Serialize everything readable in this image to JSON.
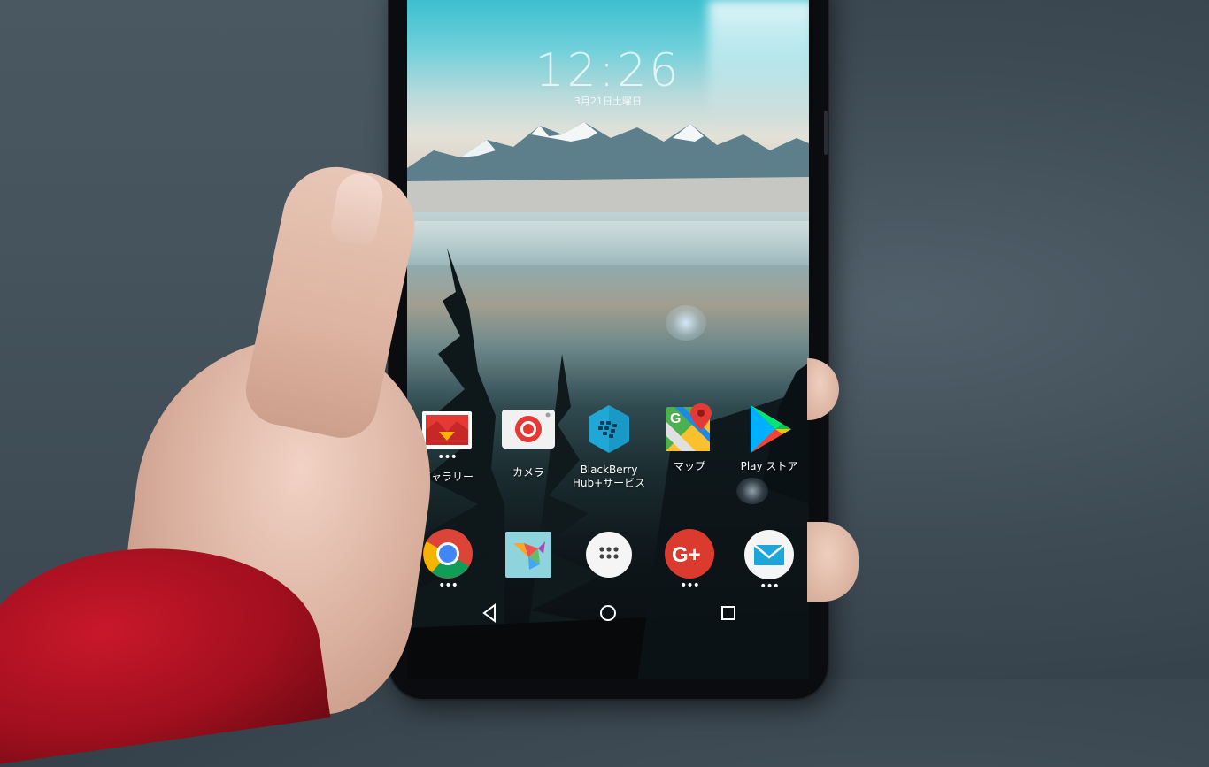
{
  "lockscreen": {
    "time": "12:26",
    "date": "3月21日土曜日"
  },
  "home_apps": [
    {
      "name": "gallery",
      "label": "ギャラリー",
      "icon": "gallery-icon",
      "has_dots": true
    },
    {
      "name": "camera",
      "label": "カメラ",
      "icon": "camera-icon",
      "has_dots": false
    },
    {
      "name": "blackberry-hub",
      "label_line1": "BlackBerry",
      "label_line2": "Hub+サービス",
      "icon": "blackberry-icon",
      "has_dots": false
    },
    {
      "name": "maps",
      "label": "マップ",
      "icon": "maps-icon",
      "has_dots": false
    },
    {
      "name": "play-store",
      "label": "Play ストア",
      "icon": "play-store-icon",
      "has_dots": false
    }
  ],
  "dock_apps": [
    {
      "name": "chrome",
      "icon": "chrome-icon",
      "has_dots": true
    },
    {
      "name": "origami-app",
      "icon": "origami-icon",
      "has_dots": false
    },
    {
      "name": "app-drawer",
      "icon": "app-drawer-icon",
      "has_dots": false
    },
    {
      "name": "google-plus",
      "icon": "google-plus-icon",
      "has_dots": true
    },
    {
      "name": "email",
      "icon": "email-icon",
      "has_dots": true
    }
  ],
  "dots_glyph": "•••",
  "navbar": {
    "back": "back-icon",
    "home": "home-icon",
    "recents": "recents-icon"
  },
  "colors": {
    "sleeve": "#b3121f",
    "skin": "#e2bba9",
    "phone_body": "#0b0c10",
    "backdrop": "#45535d"
  }
}
